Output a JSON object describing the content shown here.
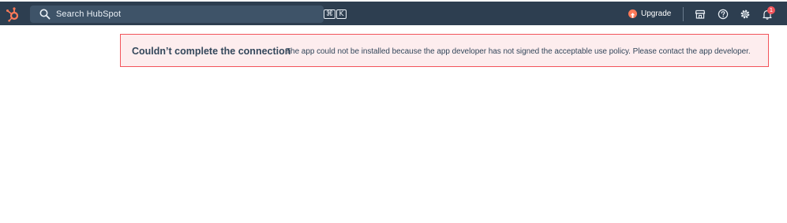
{
  "nav": {
    "logo_icon": "hubspot-sprocket-icon",
    "search": {
      "placeholder": "Search HubSpot",
      "shortcut": [
        "⌘",
        "K"
      ]
    },
    "upgrade_label": "Upgrade",
    "icons": [
      "marketplace-icon",
      "help-icon",
      "settings-icon",
      "notifications-icon"
    ],
    "notification_count": "1",
    "colors": {
      "bar": "#2d3e50",
      "accent": "#ff7a59",
      "badge": "#f2545b"
    }
  },
  "alert": {
    "title": "Couldn’t complete the connection",
    "message": "The app could not be installed because the app developer has not signed the acceptable use policy. Please contact the app developer.",
    "colors": {
      "background": "#fdedee",
      "border": "#f2545b"
    }
  }
}
